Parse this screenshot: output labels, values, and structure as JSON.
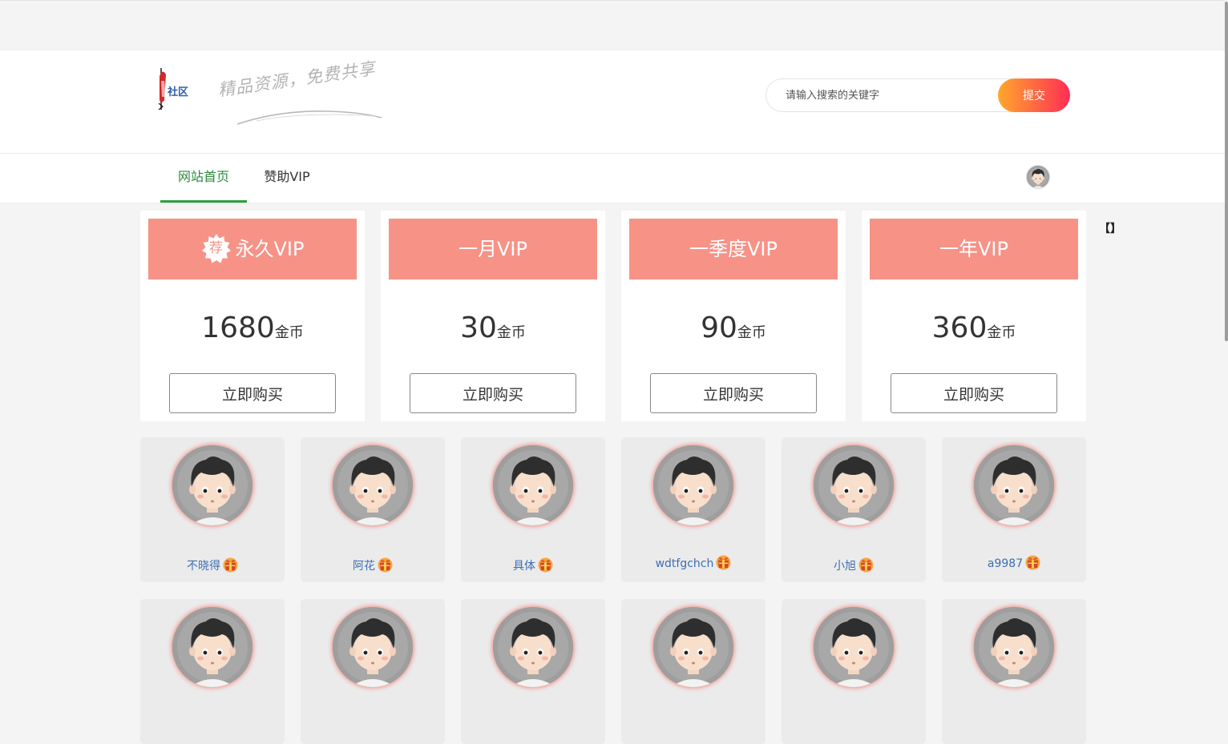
{
  "header": {
    "logo": {
      "name": "site-logo"
    },
    "slogan": "精品资源，免费共享",
    "search": {
      "placeholder": "请输入搜索的关键字",
      "value": "",
      "submit_label": "提交"
    }
  },
  "nav": {
    "items": [
      {
        "label": "网站首页",
        "active": true
      },
      {
        "label": "赞助VIP",
        "active": false
      }
    ],
    "avatar_icon": "user-avatar-icon"
  },
  "bracket_text": "【】",
  "plans": [
    {
      "title": "永久VIP",
      "badge": "荐",
      "price": "1680",
      "unit": "金币",
      "button": "立即购买"
    },
    {
      "title": "一月VIP",
      "price": "30",
      "unit": "金币",
      "button": "立即购买"
    },
    {
      "title": "一季度VIP",
      "price": "90",
      "unit": "金币",
      "button": "立即购买"
    },
    {
      "title": "一年VIP",
      "price": "360",
      "unit": "金币",
      "button": "立即购买"
    }
  ],
  "members": [
    {
      "name": "不晓得",
      "badge_icon": "vip-gift-icon"
    },
    {
      "name": "阿花",
      "badge_icon": "vip-gift-icon"
    },
    {
      "name": "具体",
      "badge_icon": "vip-gift-icon"
    },
    {
      "name": "wdtfgchch",
      "badge_icon": "vip-gift-icon"
    },
    {
      "name": "小旭",
      "badge_icon": "vip-gift-icon"
    },
    {
      "name": "a9987",
      "badge_icon": "vip-gift-icon"
    }
  ],
  "colors": {
    "plan_header": "#f79287",
    "nav_active": "#2a8a3a",
    "search_button_gradient": [
      "#ffa72c",
      "#ff2e55"
    ],
    "member_name": "#3b6fb4"
  }
}
